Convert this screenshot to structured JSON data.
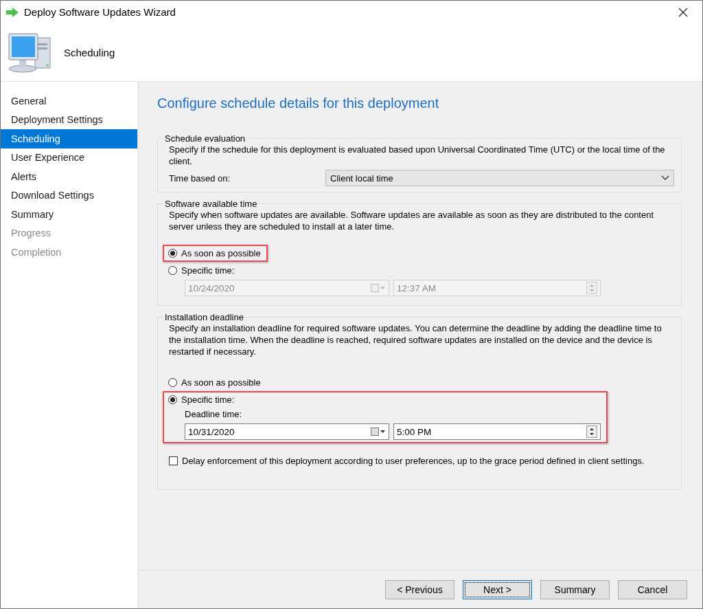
{
  "window": {
    "title": "Deploy Software Updates Wizard"
  },
  "header": {
    "title": "Scheduling"
  },
  "sidebar": {
    "items": [
      {
        "label": "General",
        "selected": false,
        "disabled": false
      },
      {
        "label": "Deployment Settings",
        "selected": false,
        "disabled": false
      },
      {
        "label": "Scheduling",
        "selected": true,
        "disabled": false
      },
      {
        "label": "User Experience",
        "selected": false,
        "disabled": false
      },
      {
        "label": "Alerts",
        "selected": false,
        "disabled": false
      },
      {
        "label": "Download Settings",
        "selected": false,
        "disabled": false
      },
      {
        "label": "Summary",
        "selected": false,
        "disabled": false
      },
      {
        "label": "Progress",
        "selected": false,
        "disabled": true
      },
      {
        "label": "Completion",
        "selected": false,
        "disabled": true
      }
    ]
  },
  "page_title": "Configure schedule details for this deployment",
  "schedule_evaluation": {
    "title": "Schedule evaluation",
    "description": "Specify if the schedule for this deployment is evaluated based upon Universal Coordinated Time (UTC) or the local time of the client.",
    "field_label": "Time based on:",
    "value": "Client local time"
  },
  "software_available_time": {
    "title": "Software available time",
    "description": "Specify when software updates are available. Software updates are available as soon as they are distributed to the content server unless they are scheduled to install at a later time.",
    "options": [
      {
        "label": "As soon as possible",
        "selected": true,
        "highlighted": true
      },
      {
        "label": "Specific time:",
        "selected": false,
        "highlighted": false,
        "date": "10/24/2020",
        "time": "12:37 AM",
        "disabled": true
      }
    ]
  },
  "installation_deadline": {
    "title": "Installation deadline",
    "description": "Specify an installation deadline for required software updates. You can determine the deadline by adding the deadline time to the installation time. When the deadline is reached, required software updates are installed on the device and the device is restarted if necessary.",
    "options": [
      {
        "label": "As soon as possible",
        "selected": false,
        "highlighted": false
      },
      {
        "label": "Specific time:",
        "selected": true,
        "highlighted": true,
        "field_label": "Deadline time:",
        "date": "10/31/2020",
        "time": "5:00 PM",
        "disabled": false
      }
    ],
    "delay_checkbox": {
      "label": "Delay enforcement of this deployment according to user preferences, up to the grace period defined in client settings.",
      "checked": false
    }
  },
  "buttons": [
    {
      "label": "< Previous",
      "default": false
    },
    {
      "label": "Next >",
      "default": true
    },
    {
      "label": "Summary",
      "default": false
    },
    {
      "label": "Cancel",
      "default": false
    }
  ]
}
